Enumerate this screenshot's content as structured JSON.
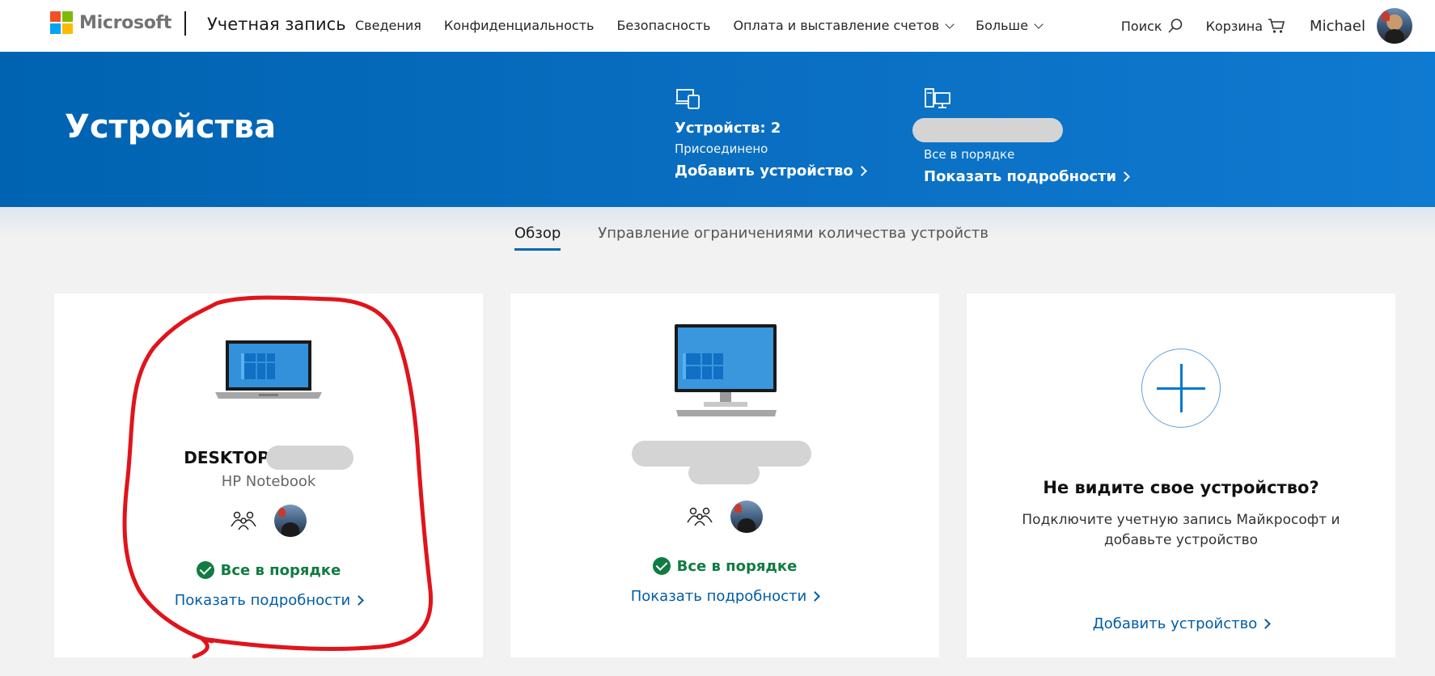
{
  "header": {
    "brand": "Microsoft",
    "account_title": "Учетная запись",
    "nav": [
      {
        "label": "Сведения",
        "dropdown": false
      },
      {
        "label": "Конфиденциальность",
        "dropdown": false
      },
      {
        "label": "Безопасность",
        "dropdown": false
      },
      {
        "label": "Оплата и выставление счетов",
        "dropdown": true
      },
      {
        "label": "Больше",
        "dropdown": true
      }
    ],
    "search_label": "Поиск",
    "cart_label": "Корзина",
    "user_name": "Michael"
  },
  "banner": {
    "title": "Устройства",
    "devices_stat": {
      "title": "Устройств: 2",
      "subtitle": "Присоединено",
      "link": "Добавить устройство"
    },
    "health_stat": {
      "subtitle": "Все в порядке",
      "link": "Показать подробности"
    }
  },
  "tabs": [
    {
      "label": "Обзор",
      "active": true
    },
    {
      "label": "Управление ограничениями количества устройств",
      "active": false
    }
  ],
  "cards": [
    {
      "type": "laptop",
      "name": "DESKTOP",
      "model": "HP Notebook",
      "status": "Все в порядке",
      "link": "Показать подробности"
    },
    {
      "type": "desktop",
      "status": "Все в порядке",
      "link": "Показать подробности"
    }
  ],
  "add_card": {
    "title": "Не видите свое устройство?",
    "description_line1": "Подключите учетную запись Майкрософт и",
    "description_line2": "добавьте устройство",
    "link": "Добавить устройство"
  },
  "colors": {
    "accent": "#0067b8",
    "banner": "#0063b1",
    "status_ok": "#107c41",
    "annotation": "#e0141b"
  }
}
